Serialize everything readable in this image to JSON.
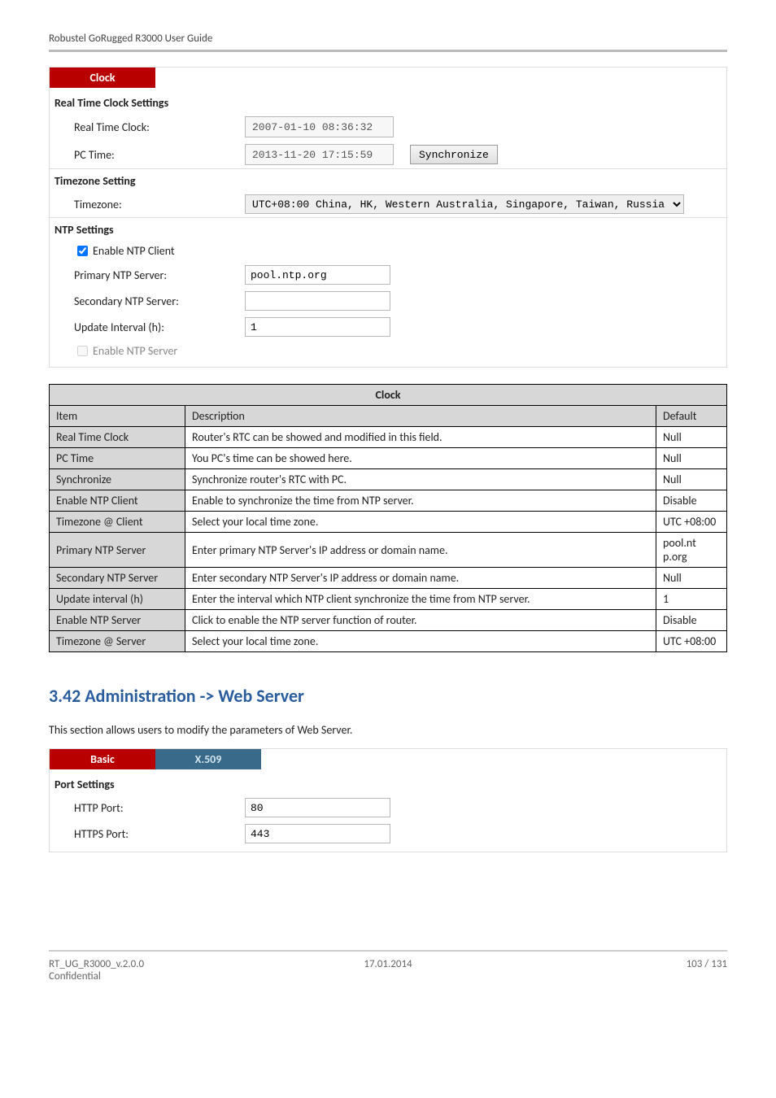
{
  "header": {
    "title": "Robustel GoRugged R3000 User Guide"
  },
  "clock_panel": {
    "tab": "Clock",
    "sections": {
      "rtc": {
        "title": "Real Time Clock Settings",
        "rtc_label": "Real Time Clock:",
        "rtc_value": "2007-01-10 08:36:32",
        "pc_label": "PC Time:",
        "pc_value": "2013-11-20 17:15:59",
        "sync_btn": "Synchronize"
      },
      "tz": {
        "title": "Timezone Setting",
        "label": "Timezone:",
        "value": "UTC+08:00 China, HK, Western Australia, Singapore, Taiwan, Russia"
      },
      "ntp": {
        "title": "NTP Settings",
        "enable_client": "Enable NTP Client",
        "primary_label": "Primary NTP Server:",
        "primary_value": "pool.ntp.org",
        "secondary_label": "Secondary NTP Server:",
        "secondary_value": "",
        "interval_label": "Update Interval (h):",
        "interval_value": "1",
        "enable_server": "Enable NTP Server"
      }
    }
  },
  "clock_table": {
    "title": "Clock",
    "head": {
      "item": "Item",
      "desc": "Description",
      "def": "Default"
    },
    "rows": [
      {
        "item": "Real Time Clock",
        "desc": "Router's RTC can be showed and modified in this field.",
        "def": "Null"
      },
      {
        "item": "PC Time",
        "desc": "You PC's time can be showed here.",
        "def": "Null"
      },
      {
        "item": "Synchronize",
        "desc": "Synchronize router's RTC with PC.",
        "def": "Null"
      },
      {
        "item": "Enable NTP Client",
        "desc": "Enable to synchronize the time from NTP server.",
        "def": "Disable"
      },
      {
        "item": "Timezone @ Client",
        "desc": "Select your local time zone.",
        "def": "UTC +08:00"
      },
      {
        "item": "Primary NTP Server",
        "desc": "Enter primary NTP Server's IP address or domain name.",
        "def": "pool.nt p.org"
      },
      {
        "item": "Secondary NTP Server",
        "desc": "Enter secondary NTP Server's IP address or domain name.",
        "def": "Null"
      },
      {
        "item": "Update interval (h)",
        "desc": "Enter the interval which NTP client synchronize the time from NTP server.",
        "def": "1"
      },
      {
        "item": "Enable NTP Server",
        "desc": "Click to enable the NTP server function of router.",
        "def": "Disable"
      },
      {
        "item": "Timezone @ Server",
        "desc": "Select your local time zone.",
        "def": "UTC +08:00"
      }
    ]
  },
  "section": {
    "heading": "3.42  Administration -> Web Server",
    "intro": "This section allows users to modify the parameters of Web Server."
  },
  "webserver_panel": {
    "tab_active": "Basic",
    "tab_inactive": "X.509",
    "section_title": "Port Settings",
    "http_label": "HTTP Port:",
    "http_value": "80",
    "https_label": "HTTPS Port:",
    "https_value": "443"
  },
  "footer": {
    "left": "RT_UG_R3000_v.2.0.0",
    "center": "17.01.2014",
    "right": "103 / 131",
    "sub": "Confidential"
  }
}
